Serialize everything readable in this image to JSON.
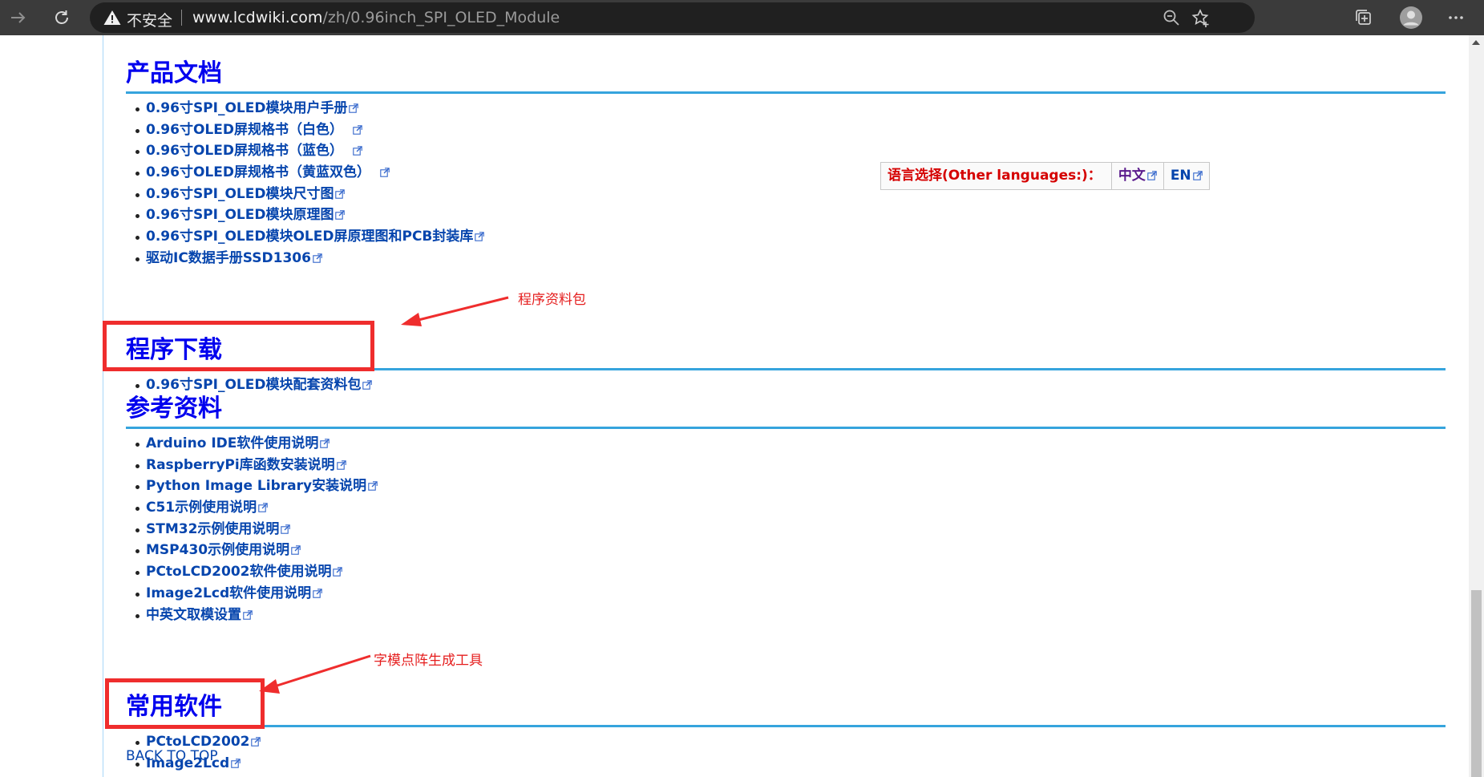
{
  "browser": {
    "security_label": "不安全",
    "url_host": "www.lcdwiki.com",
    "url_path": "/zh/0.96inch_SPI_OLED_Module"
  },
  "language_box": {
    "label": "语言选择(Other languages:)：",
    "options": [
      {
        "label": "中文"
      },
      {
        "label": "EN"
      }
    ]
  },
  "sections": {
    "product_docs": {
      "title": "产品文档",
      "items": [
        "0.96寸SPI_OLED模块用户手册",
        "0.96寸OLED屏规格书（白色）",
        "0.96寸OLED屏规格书（蓝色）",
        "0.96寸OLED屏规格书（黄蓝双色）",
        "0.96寸SPI_OLED模块尺寸图",
        "0.96寸SPI_OLED模块原理图",
        "0.96寸SPI_OLED模块OLED屏原理图和PCB封装库",
        "驱动IC数据手册SSD1306"
      ]
    },
    "program_download": {
      "title": "程序下载",
      "items": [
        "0.96寸SPI_OLED模块配套资料包"
      ]
    },
    "reference": {
      "title": "参考资料",
      "items": [
        "Arduino IDE软件使用说明",
        "RaspberryPi库函数安装说明",
        "Python Image Library安装说明",
        "C51示例使用说明",
        "STM32示例使用说明",
        "MSP430示例使用说明",
        "PCtoLCD2002软件使用说明",
        "Image2Lcd软件使用说明",
        "中英文取模设置"
      ]
    },
    "common_software": {
      "title": "常用软件",
      "items": [
        "PCtoLCD2002",
        "Image2Lcd"
      ]
    }
  },
  "back_to_top": "BACK TO TOP",
  "annotations": {
    "program_package": "程序资料包",
    "font_tool": "字模点阵生成工具"
  },
  "colors": {
    "section_title": "#0000ee",
    "link": "#0645ad",
    "section_rule": "#36a4dd",
    "annotation_red": "#ef2d2d",
    "language_label": "#d50000"
  }
}
